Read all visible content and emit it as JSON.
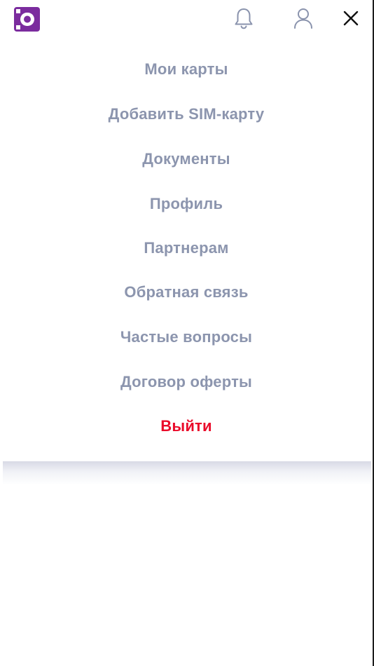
{
  "header": {
    "logo_icon": "brand-logo-icon",
    "bell_icon": "bell-icon",
    "user_icon": "user-icon",
    "close_icon": "close-icon",
    "brand_color": "#7b2c9e"
  },
  "menu": {
    "items": [
      {
        "label": "Мои карты"
      },
      {
        "label": "Добавить SIM-карту"
      },
      {
        "label": "Документы"
      },
      {
        "label": "Профиль"
      },
      {
        "label": "Партнерам"
      },
      {
        "label": "Обратная связь"
      },
      {
        "label": "Частые вопросы"
      },
      {
        "label": "Договор оферты"
      }
    ],
    "logout_label": "Выйти",
    "item_color": "#8c95ae",
    "logout_color": "#ea0a2a"
  }
}
